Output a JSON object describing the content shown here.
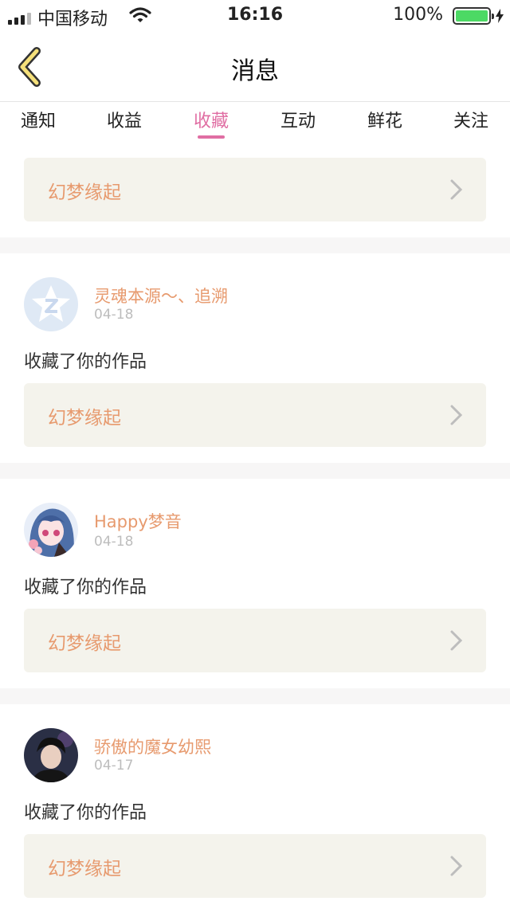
{
  "status_bar": {
    "carrier": "中国移动",
    "time": "16:16",
    "battery": "100%"
  },
  "header": {
    "title": "消息"
  },
  "tabs": [
    {
      "label": "通知",
      "active": false
    },
    {
      "label": "收益",
      "active": false
    },
    {
      "label": "收藏",
      "active": true
    },
    {
      "label": "互动",
      "active": false
    },
    {
      "label": "鲜花",
      "active": false
    },
    {
      "label": "关注",
      "active": false
    }
  ],
  "top_card": {
    "work_title": "幻梦缘起"
  },
  "messages": [
    {
      "user": "灵魂本源～、追溯",
      "date": "04-18",
      "action": "收藏了你的作品",
      "work_title": "幻梦缘起",
      "avatar": "qq-default-avatar"
    },
    {
      "user": "Happy梦音",
      "date": "04-18",
      "action": "收藏了你的作品",
      "work_title": "幻梦缘起",
      "avatar": "anime-girl-avatar"
    },
    {
      "user": "骄傲的魔女幼熙",
      "date": "04-17",
      "action": "收藏了你的作品",
      "work_title": "幻梦缘起",
      "avatar": "male-photo-avatar"
    }
  ],
  "colors": {
    "accent": "#e06ea3",
    "username": "#e79a6e",
    "work_bg": "#f4f3ec"
  }
}
